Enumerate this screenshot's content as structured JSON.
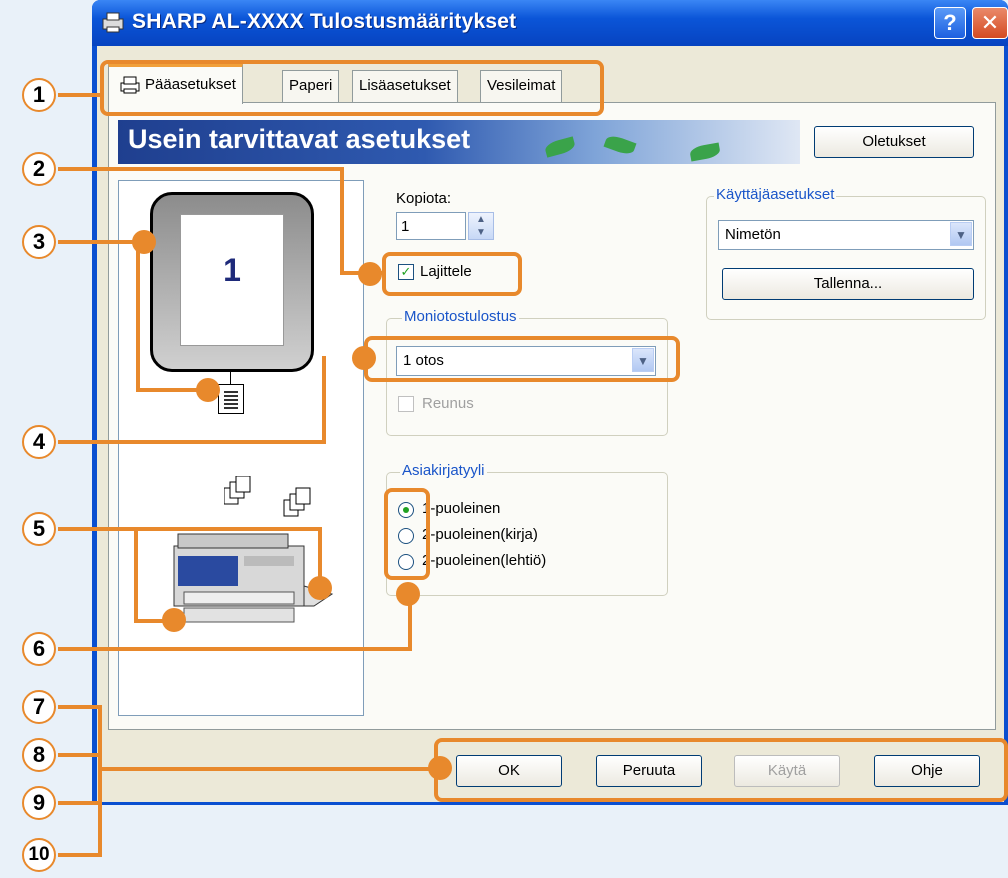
{
  "window": {
    "title": "SHARP AL-XXXX  Tulostusmääritykset",
    "help_label": "?",
    "close_label": "✕"
  },
  "tabs": [
    {
      "label": "Pääasetukset",
      "active": true
    },
    {
      "label": "Paperi"
    },
    {
      "label": "Lisäasetukset"
    },
    {
      "label": "Vesileimat"
    }
  ],
  "banner": {
    "text": "Usein tarvittavat asetukset"
  },
  "defaults_button": "Oletukset",
  "preview": {
    "page_number": "1"
  },
  "copies": {
    "label": "Kopiota:",
    "value": "1"
  },
  "collate": {
    "label": "Lajittele",
    "checked": true
  },
  "user_settings": {
    "group_label": "Käyttäjäasetukset",
    "selected": "Nimetön",
    "save_button": "Tallenna..."
  },
  "nup": {
    "group_label": "Moniotostulostus",
    "selected": "1 otos",
    "border_label": "Reunus"
  },
  "document_style": {
    "group_label": "Asiakirjatyyli",
    "options": [
      {
        "label": "1-puoleinen",
        "selected": true
      },
      {
        "label": "2-puoleinen(kirja)"
      },
      {
        "label": "2-puoleinen(lehtiö)"
      }
    ]
  },
  "bottom_buttons": {
    "ok": "OK",
    "cancel": "Peruuta",
    "apply": "Käytä",
    "help": "Ohje"
  },
  "callouts": [
    "1",
    "2",
    "3",
    "4",
    "5",
    "6",
    "7",
    "8",
    "9",
    "10"
  ],
  "colors": {
    "callout": "#e8892c",
    "titlebar": "#0b55d8"
  }
}
